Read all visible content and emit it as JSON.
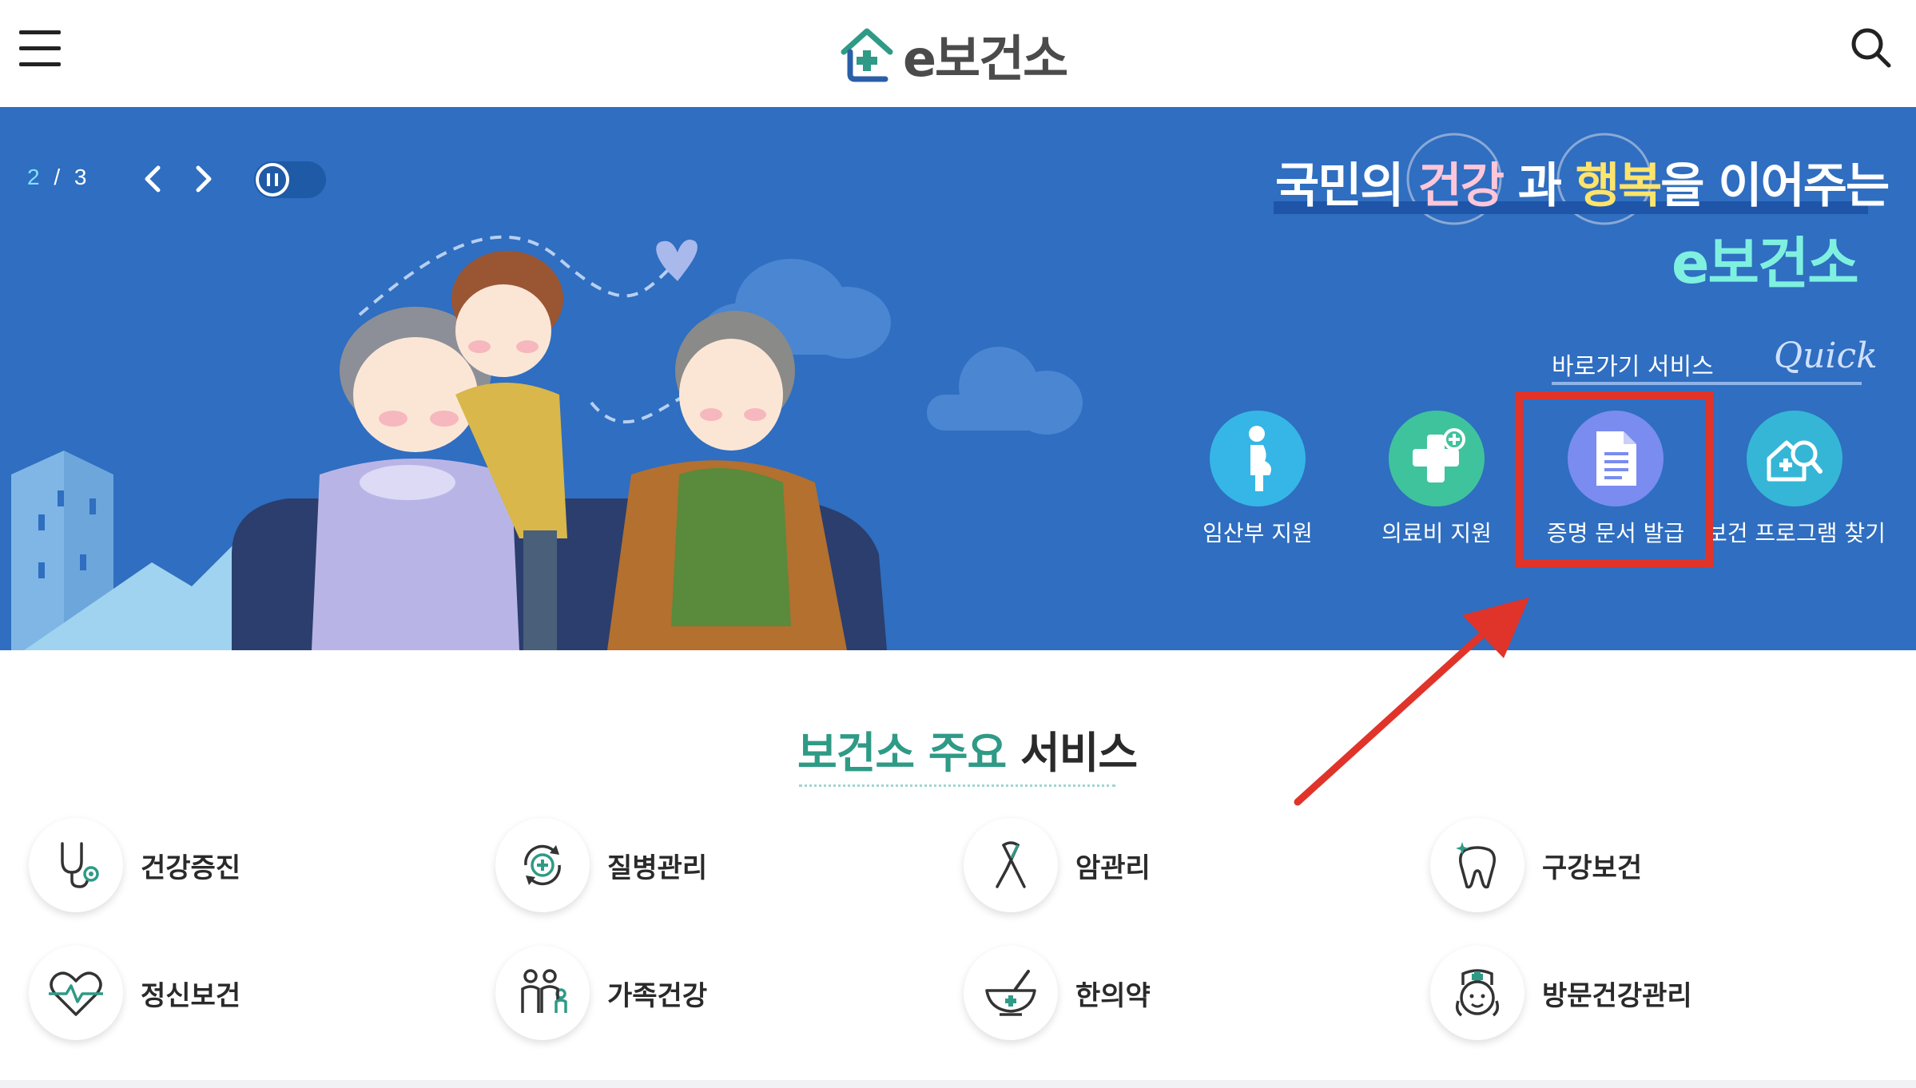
{
  "header": {
    "logo_text": "e보건소",
    "menu_icon": "hamburger-menu-icon",
    "search_icon": "search-icon"
  },
  "hero": {
    "slide_current": "2",
    "slide_separator": "/",
    "slide_total": "3",
    "title_part1": "국민의",
    "title_hl1": "건강",
    "title_part2": "과",
    "title_hl2": "행복",
    "title_part3": "을 이어주는",
    "subtitle": "e보건소",
    "quick_label": "바로가기 서비스",
    "quick_script": "Quick",
    "quick_items": [
      {
        "label": "임산부 지원",
        "icon": "pregnant-woman-icon",
        "color": "#35b6e6"
      },
      {
        "label": "의료비 지원",
        "icon": "medical-plus-icon",
        "color": "#3fc39d"
      },
      {
        "label": "증명 문서 발급",
        "icon": "document-icon",
        "color": "#7a8cf0"
      },
      {
        "label": "보건 프로그램 찾기",
        "icon": "program-search-icon",
        "color": "#35b6d6"
      }
    ]
  },
  "section": {
    "title_green": "보건소 주요",
    "title_dark": "서비스",
    "items": [
      {
        "label": "건강증진",
        "icon": "stethoscope-icon"
      },
      {
        "label": "질병관리",
        "icon": "disease-cycle-icon"
      },
      {
        "label": "암관리",
        "icon": "cancer-ribbon-icon"
      },
      {
        "label": "구강보건",
        "icon": "tooth-icon"
      },
      {
        "label": "정신보건",
        "icon": "heartbeat-icon"
      },
      {
        "label": "가족건강",
        "icon": "family-icon"
      },
      {
        "label": "한의약",
        "icon": "mortar-bowl-icon"
      },
      {
        "label": "방문건강관리",
        "icon": "nurse-icon"
      }
    ]
  },
  "colors": {
    "hero_bg": "#2f6ec0",
    "accent_green": "#2f9a86",
    "highlight_red": "#e0342a"
  }
}
